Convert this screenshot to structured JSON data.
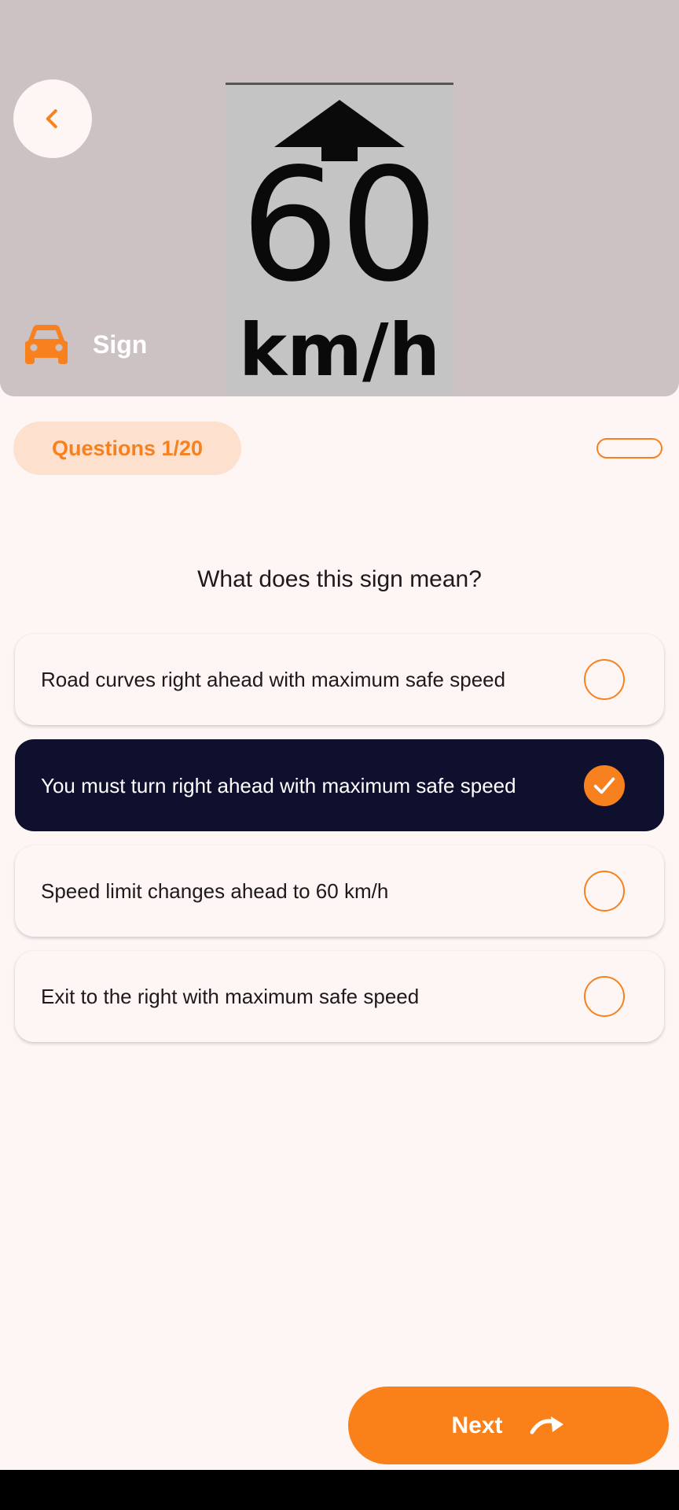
{
  "colors": {
    "accent": "#f7811f",
    "selected_bg": "#0f0f2e",
    "hero_bg": "#cdc2c3",
    "page_bg": "#fdf6f5"
  },
  "hero": {
    "sign_number": "60",
    "sign_unit": "km/h",
    "category_icon": "car-icon",
    "category_label": "Sign"
  },
  "progress": {
    "label": "Questions 1/20"
  },
  "question": {
    "text": "What does this sign mean?"
  },
  "options": [
    {
      "text": "Road curves right ahead with maximum safe speed",
      "selected": false
    },
    {
      "text": "You must turn right ahead with maximum safe speed",
      "selected": true
    },
    {
      "text": "Speed limit changes ahead to 60 km/h",
      "selected": false
    },
    {
      "text": "Exit to the right with maximum safe speed",
      "selected": false
    }
  ],
  "footer": {
    "next_label": "Next"
  }
}
